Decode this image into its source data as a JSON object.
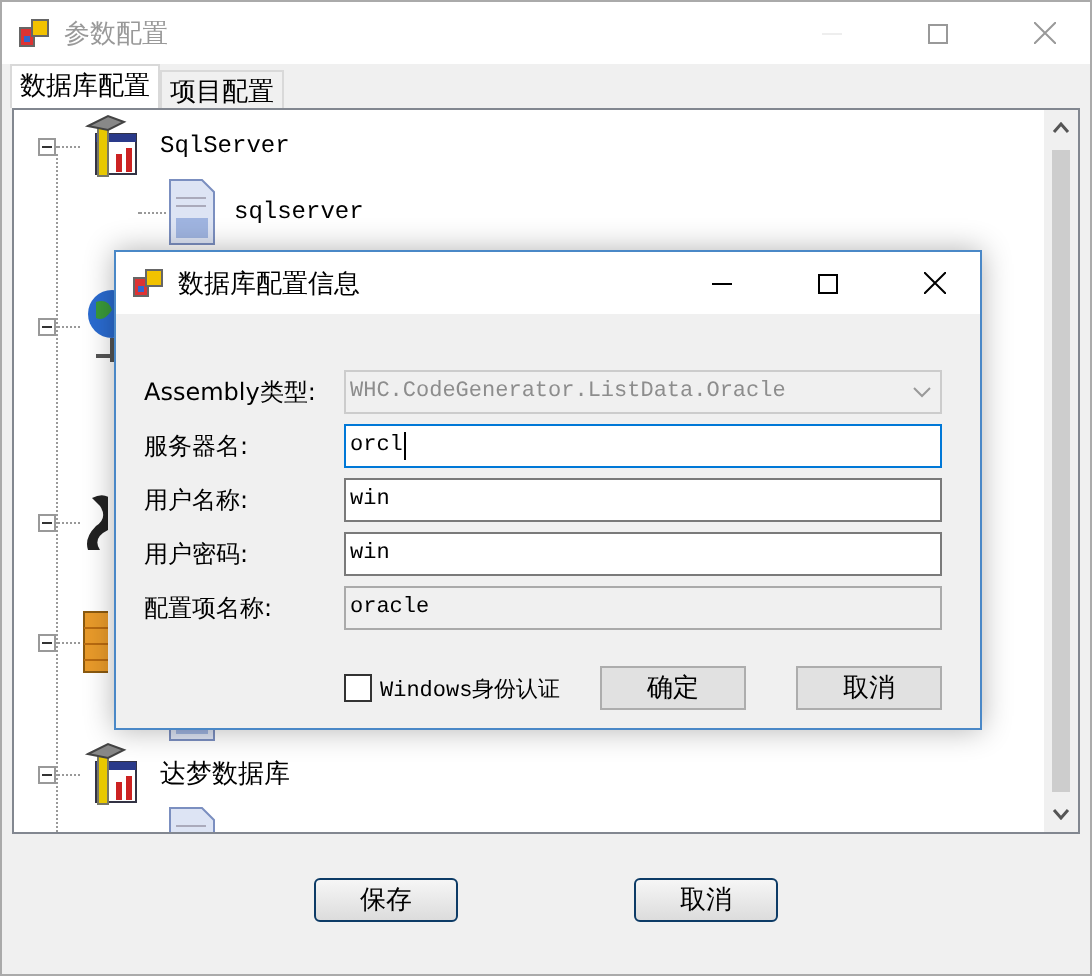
{
  "window": {
    "title": "参数配置",
    "active": false
  },
  "tabs": [
    {
      "label": "数据库配置",
      "selected": true
    },
    {
      "label": "项目配置",
      "selected": false
    }
  ],
  "tree": [
    {
      "kind": "tool",
      "label": "SqlServer",
      "expanded": true,
      "children": [
        {
          "kind": "document",
          "label": "sqlserver"
        }
      ]
    },
    {
      "kind": "globe",
      "expanded": true
    },
    {
      "kind": "script",
      "expanded": true
    },
    {
      "kind": "stack",
      "expanded": true,
      "children": [
        {
          "kind": "document"
        }
      ]
    },
    {
      "kind": "tool",
      "label": "达梦数据库",
      "expanded": true,
      "children": [
        {
          "kind": "document"
        }
      ]
    }
  ],
  "dialog": {
    "title": "数据库配置信息",
    "fields": [
      {
        "label": "Assembly类型:",
        "value": "WHC.CodeGenerator.ListData.Oracle",
        "kind": "combo",
        "disabled": true,
        "focused": false
      },
      {
        "label": "服务器名:",
        "value": "orcl",
        "kind": "text",
        "disabled": false,
        "focused": true
      },
      {
        "label": "用户名称:",
        "value": "win",
        "kind": "text",
        "disabled": false,
        "focused": false
      },
      {
        "label": "用户密码:",
        "value": "win",
        "kind": "text",
        "disabled": false,
        "focused": false
      },
      {
        "label": "配置项名称:",
        "value": "oracle",
        "kind": "text",
        "disabled": true,
        "focused": false
      }
    ],
    "checkbox": {
      "label": "Windows身份认证",
      "checked": false
    },
    "buttons": [
      "确定",
      "取消"
    ]
  },
  "buttons": [
    "保存",
    "取消"
  ]
}
